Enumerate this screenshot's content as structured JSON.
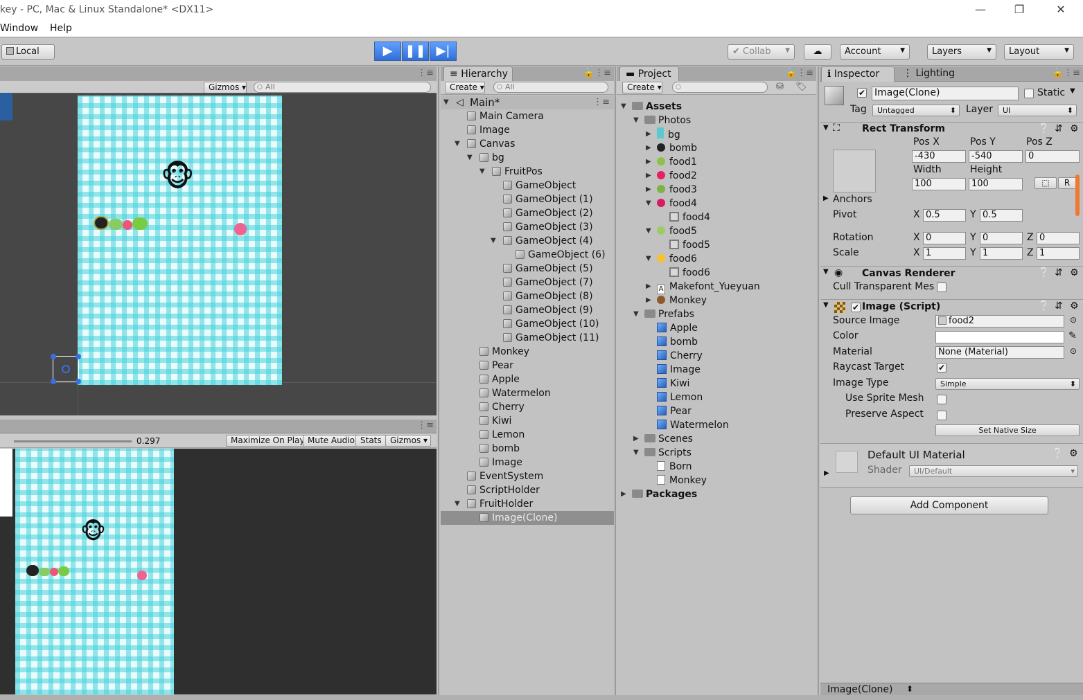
{
  "window": {
    "title": "key - PC, Mac & Linux Standalone* <DX11>",
    "minimize": "—",
    "restore": "❐",
    "close": "✕"
  },
  "menu": [
    "Window",
    "Help"
  ],
  "toolbar": {
    "local": "Local",
    "collab": "Collab",
    "account": "Account",
    "layers": "Layers",
    "layout": "Layout"
  },
  "scene": {
    "gizmos": "Gizmos",
    "search": "All"
  },
  "game": {
    "scale": "0.297",
    "maximize": "Maximize On Play",
    "mute": "Mute Audio",
    "stats": "Stats",
    "gizmos": "Gizmos"
  },
  "hierarchy": {
    "tab": "Hierarchy",
    "create": "Create",
    "search": "All",
    "scene": "Main*",
    "rows": [
      "Main Camera",
      "Image",
      "Canvas",
      "bg",
      "FruitPos",
      "GameObject",
      "GameObject (1)",
      "GameObject (2)",
      "GameObject (3)",
      "GameObject (4)",
      "GameObject (6)",
      "GameObject (5)",
      "GameObject (7)",
      "GameObject (8)",
      "GameObject (9)",
      "GameObject (10)",
      "GameObject (11)",
      "Monkey",
      "Pear",
      "Apple",
      "Watermelon",
      "Cherry",
      "Kiwi",
      "Lemon",
      "bomb",
      "Image",
      "EventSystem",
      "ScriptHolder",
      "FruitHolder",
      "Image(Clone)"
    ]
  },
  "project": {
    "tab": "Project",
    "create": "Create",
    "rows": [
      "Assets",
      "Photos",
      "bg",
      "bomb",
      "food1",
      "food2",
      "food3",
      "food4",
      "food4",
      "food5",
      "food5",
      "food6",
      "food6",
      "Makefont_Yueyuan",
      "Monkey",
      "Prefabs",
      "Apple",
      "bomb",
      "Cherry",
      "Image",
      "Kiwi",
      "Lemon",
      "Pear",
      "Watermelon",
      "Scenes",
      "Scripts",
      "Born",
      "Monkey",
      "Packages"
    ]
  },
  "inspector": {
    "tab": "Inspector",
    "tab2": "Lighting",
    "name": "Image(Clone)",
    "static": "Static",
    "tag_label": "Tag",
    "tag": "Untagged",
    "layer_label": "Layer",
    "layer": "UI",
    "rect": {
      "title": "Rect Transform",
      "posx_l": "Pos X",
      "posy_l": "Pos Y",
      "posz_l": "Pos Z",
      "posx": "-430",
      "posy": "-540",
      "posz": "0",
      "width_l": "Width",
      "height_l": "Height",
      "width": "100",
      "height": "100",
      "anchors": "Anchors",
      "pivot": "Pivot",
      "px": "0.5",
      "py": "0.5",
      "rotation": "Rotation",
      "rx": "0",
      "ry": "0",
      "rz": "0",
      "scale": "Scale",
      "sx": "1",
      "sy": "1",
      "sz": "1",
      "x": "X",
      "y": "Y",
      "z": "Z",
      "r": "R"
    },
    "canvas_renderer": {
      "title": "Canvas Renderer",
      "cull": "Cull Transparent Mes"
    },
    "image": {
      "title": "Image (Script)",
      "source_l": "Source Image",
      "source": "food2",
      "color_l": "Color",
      "material_l": "Material",
      "material": "None (Material)",
      "raycast_l": "Raycast Target",
      "type_l": "Image Type",
      "type": "Simple",
      "sprite_mesh": "Use Sprite Mesh",
      "preserve": "Preserve Aspect",
      "native": "Set Native Size"
    },
    "material": {
      "title": "Default UI Material",
      "shader_l": "Shader",
      "shader": "UI/Default"
    },
    "add": "Add Component",
    "footer": "Image(Clone)"
  }
}
